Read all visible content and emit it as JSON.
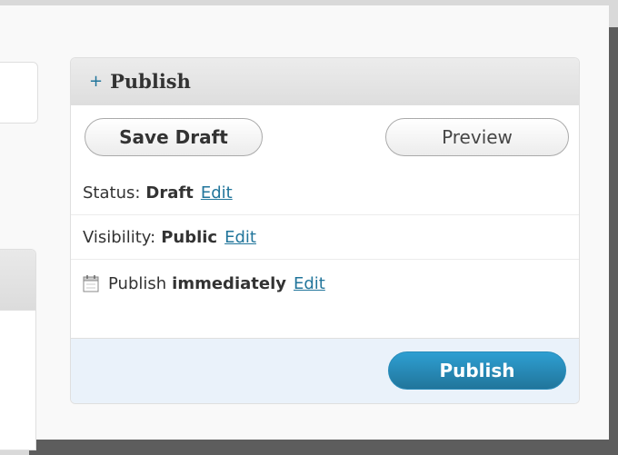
{
  "publish_box": {
    "title": "Publish",
    "toggle_icon": "+",
    "save_draft_label": "Save Draft",
    "preview_label": "Preview",
    "status": {
      "label": "Status:",
      "value": "Draft",
      "edit": "Edit"
    },
    "visibility": {
      "label": "Visibility:",
      "value": "Public",
      "edit": "Edit"
    },
    "schedule": {
      "icon": "calendar-icon",
      "label": "Publish",
      "value": "immediately",
      "edit": "Edit"
    },
    "publish_label": "Publish"
  },
  "colors": {
    "link": "#21759b",
    "publish_button": "#21759b",
    "major_actions_bg": "#eaf2fa",
    "header_bg": "#e5e5e5"
  }
}
